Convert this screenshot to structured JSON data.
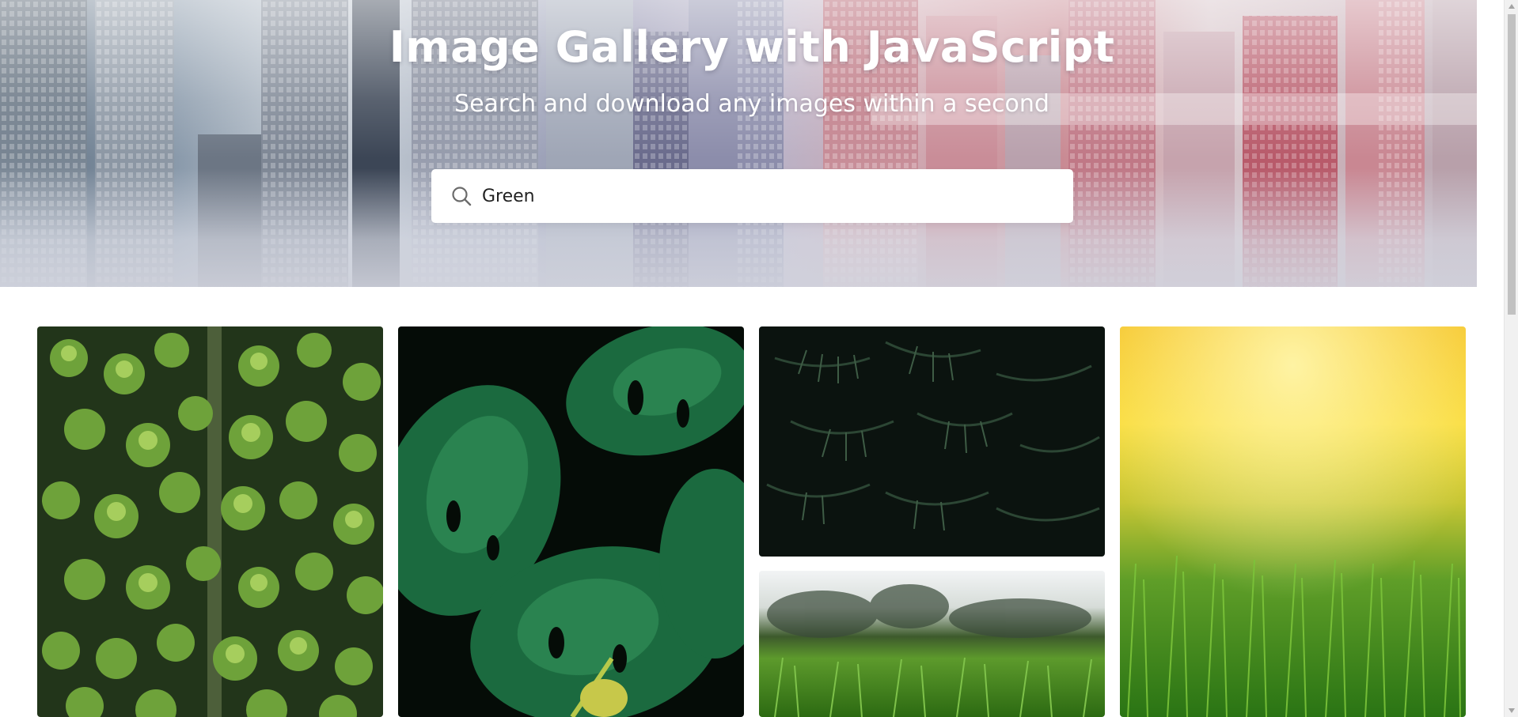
{
  "hero": {
    "title": "Image Gallery with JavaScript",
    "subtitle": "Search and download any images within a second"
  },
  "search": {
    "value": "Green",
    "icon": "search-icon"
  },
  "gallery": {
    "images": [
      {
        "subject": "aerial forest",
        "colors": [
          "#24361a",
          "#6fa23a",
          "#b9d96a"
        ]
      },
      {
        "subject": "monstera leaves",
        "colors": [
          "#061009",
          "#0f4a2c",
          "#2f8a55"
        ]
      },
      {
        "subject": "dark fern",
        "colors": [
          "#0b130f",
          "#1c2f23",
          "#36523c"
        ]
      },
      {
        "subject": "grass meadow",
        "colors": [
          "#e9eef0",
          "#5a8d2b",
          "#2f6a12"
        ]
      },
      {
        "subject": "sunlit grass",
        "colors": [
          "#f9d62a",
          "#9bc030",
          "#2b7a14"
        ]
      }
    ]
  },
  "colors": {
    "hero_text": "#ffffff",
    "search_bg": "#ffffff",
    "page_bg": "#ffffff"
  }
}
